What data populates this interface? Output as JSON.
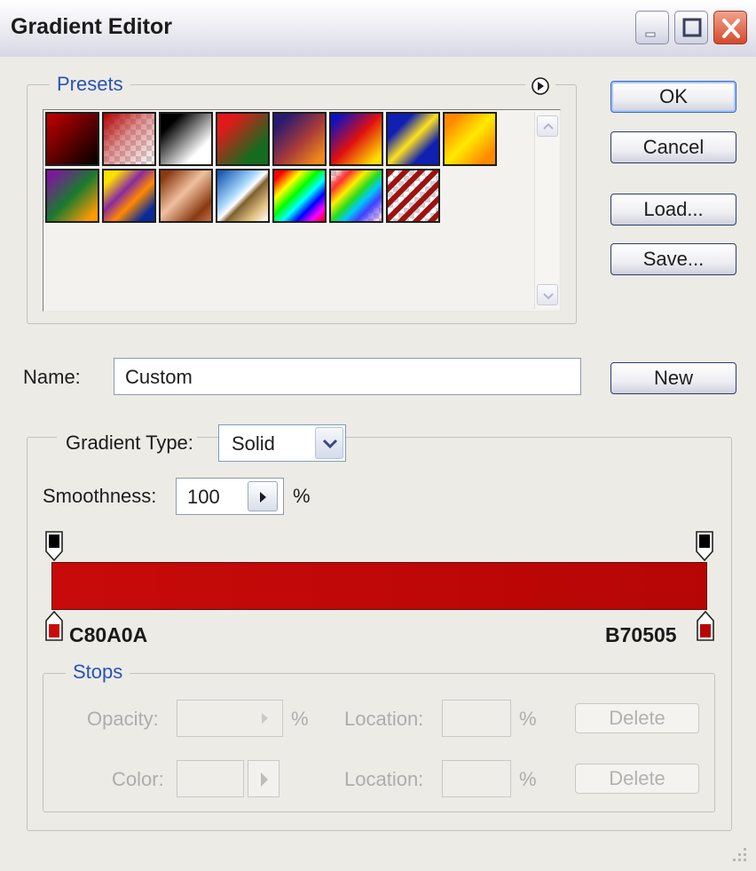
{
  "window": {
    "title": "Gradient Editor",
    "caption_buttons": [
      "minimize-icon",
      "maximize-icon",
      "close-icon"
    ]
  },
  "presets": {
    "legend": "Presets",
    "menu_icon": "circle-arrow-icon",
    "swatches": [
      {
        "name": "foreground-to-background",
        "css": "linear-gradient(135deg,#c40000 0%,#6a0000 45%,#000000 100%)"
      },
      {
        "name": "foreground-to-transparent",
        "css": "linear-gradient(135deg,#b00000 0%,rgba(200,60,60,0.55) 45%,rgba(255,255,255,0) 100%)",
        "checker": true
      },
      {
        "name": "black-white",
        "css": "linear-gradient(135deg,#000000 20%,#ffffff 75%)"
      },
      {
        "name": "red-green",
        "css": "linear-gradient(135deg,#e01a1a 20%,#156b1e 75%)"
      },
      {
        "name": "violet-orange",
        "css": "linear-gradient(135deg,#2a1a70 15%,#a83a3a 55%,#f08a1a 90%)"
      },
      {
        "name": "blue-red-yellow",
        "css": "linear-gradient(135deg,#1010c0 10%,#e01010 50%,#ffe000 90%)"
      },
      {
        "name": "blue-yellow-blue",
        "css": "linear-gradient(135deg,#1020b0 25%,#ffe020 50%,#1020b0 75%)"
      },
      {
        "name": "orange-yellow-orange",
        "css": "linear-gradient(135deg,#ff8a00 15%,#ffea00 50%,#ff8a00 85%)"
      },
      {
        "name": "violet-green-orange",
        "css": "linear-gradient(135deg,#7a1a9a 10%,#1a7a30 50%,#ff9a00 90%)"
      },
      {
        "name": "yellow-violet-orange-blue",
        "css": "linear-gradient(135deg,#ffe000 15%,#8a2aa0 40%,#ff8a00 60%,#0a2a9a 85%)"
      },
      {
        "name": "copper",
        "css": "linear-gradient(135deg,#8a3a10 10%,#f0c0a0 45%,#8a3a10 80%,#c07050 100%)"
      },
      {
        "name": "chrome",
        "css": "linear-gradient(135deg,#1a5ab0 5%,#a8d8ff 40%,#ffffff 50%,#806030 58%,#e0c080 80%,#ffffff 100%)"
      },
      {
        "name": "spectrum",
        "css": "linear-gradient(135deg,#ff0000 10%,#ffff00 28%,#00ff00 44%,#00ffff 58%,#0000ff 72%,#ff00ff 86%,#ff0000 100%)"
      },
      {
        "name": "transparent-rainbow",
        "css": "linear-gradient(135deg,rgba(255,0,0,0.1) 5%,#ff3030 20%,#ffee00 35%,#22dd22 50%,#00c8ff 62%,#4040ff 75%,rgba(180,0,255,0.2) 95%)",
        "checker": true
      },
      {
        "name": "transparent-stripes",
        "css": "repeating-linear-gradient(135deg,#a01010 0px,#a01010 6px,rgba(255,255,255,0) 6px,rgba(255,255,255,0) 12px)",
        "checker": true
      }
    ]
  },
  "buttons": {
    "ok": "OK",
    "cancel": "Cancel",
    "load": "Load...",
    "save": "Save...",
    "new": "New"
  },
  "name_field": {
    "label": "Name:",
    "value": "Custom"
  },
  "gradient": {
    "type_label": "Gradient Type:",
    "type_value": "Solid",
    "smoothness_label": "Smoothness:",
    "smoothness_value": "100",
    "smoothness_unit": "%",
    "left_color_hex": "C80A0A",
    "right_color_hex": "B70505",
    "left_color": "#c80a0a",
    "right_color": "#b70505"
  },
  "stops": {
    "legend": "Stops",
    "opacity_label": "Opacity:",
    "opacity_unit": "%",
    "color_label": "Color:",
    "location_label": "Location:",
    "location_unit": "%",
    "delete_label": "Delete"
  }
}
